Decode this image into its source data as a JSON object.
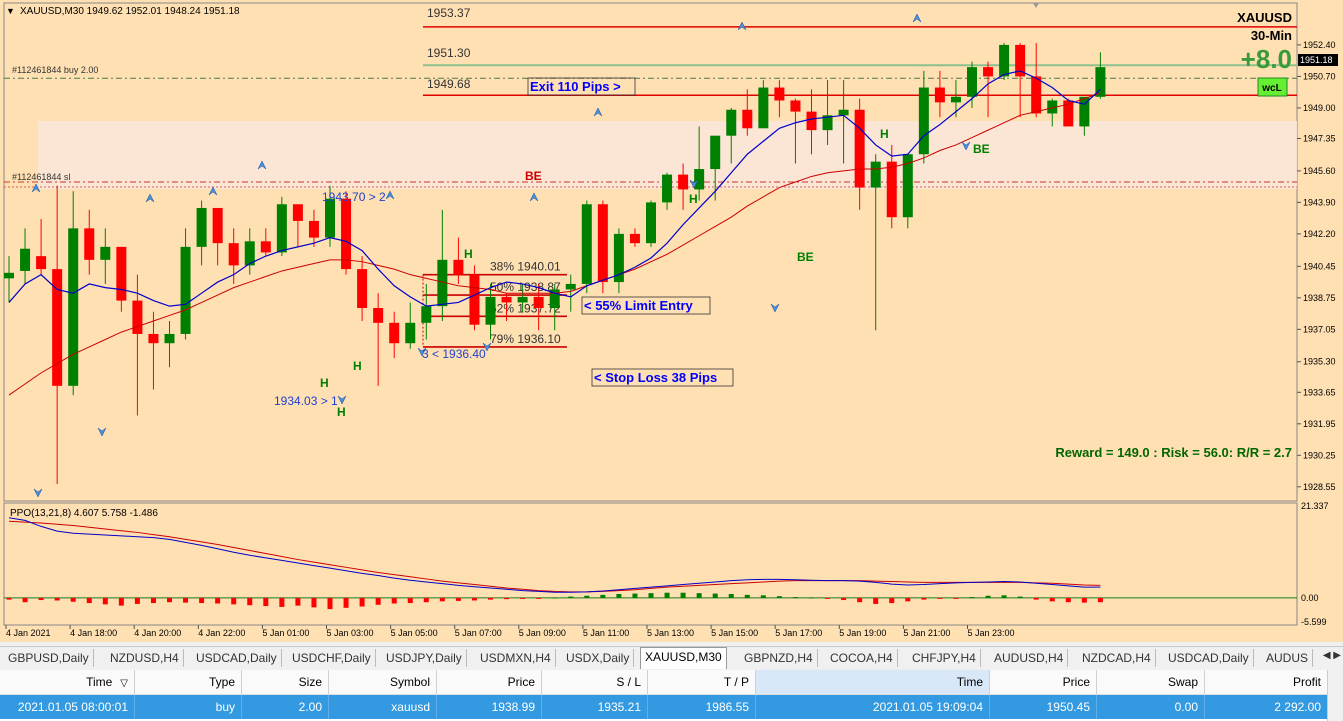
{
  "header": {
    "symbol_info": "XAUUSD,M30  1949.62 1952.01 1948.24 1951.18"
  },
  "overlay": {
    "symbol": "XAUUSD",
    "timeframe": "30-Min",
    "profit_text": "+8.0",
    "badge": "wcL",
    "rr_text": "Reward = 149.0 : Risk = 56.0: R/R = 2.7"
  },
  "colors": {
    "background": "#ffe0b3",
    "bull": "#008000",
    "bear": "#ff0000",
    "ma_fast": "#0000cc",
    "ma_slow": "#cc0000",
    "zone": "#fbe6d8",
    "label_blue": "#0000ff",
    "label_green": "#008000",
    "label_red": "#cc0000"
  },
  "chart_data": [
    {
      "type": "candlestick",
      "title": "XAUUSD,M30",
      "price_ticks": [
        "1952.40",
        "1950.70",
        "1949.00",
        "1947.35",
        "1945.60",
        "1943.90",
        "1942.20",
        "1940.45",
        "1938.75",
        "1937.05",
        "1935.30",
        "1933.65",
        "1931.95",
        "1930.25",
        "1928.55"
      ],
      "current_price": "1951.18",
      "ylim": [
        1928.0,
        1954.5
      ],
      "time_labels": [
        "4 Jan 2021",
        "4 Jan 18:00",
        "4 Jan 20:00",
        "4 Jan 22:00",
        "5 Jan 01:00",
        "5 Jan 03:00",
        "5 Jan 05:00",
        "5 Jan 07:00",
        "5 Jan 09:00",
        "5 Jan 11:00",
        "5 Jan 13:00",
        "5 Jan 15:00",
        "5 Jan 17:00",
        "5 Jan 19:00",
        "5 Jan 21:00",
        "5 Jan 23:00"
      ],
      "candles": [
        {
          "o": 1939.8,
          "h": 1941.0,
          "l": 1938.5,
          "c": 1940.1
        },
        {
          "o": 1940.2,
          "h": 1942.5,
          "l": 1939.5,
          "c": 1941.4
        },
        {
          "o": 1941.0,
          "h": 1943.0,
          "l": 1940.0,
          "c": 1940.3
        },
        {
          "o": 1940.3,
          "h": 1944.8,
          "l": 1928.7,
          "c": 1934.0
        },
        {
          "o": 1934.0,
          "h": 1944.5,
          "l": 1933.5,
          "c": 1942.5
        },
        {
          "o": 1942.5,
          "h": 1943.5,
          "l": 1940.0,
          "c": 1940.8
        },
        {
          "o": 1940.8,
          "h": 1942.5,
          "l": 1939.5,
          "c": 1941.5
        },
        {
          "o": 1941.5,
          "h": 1941.0,
          "l": 1938.0,
          "c": 1938.6
        },
        {
          "o": 1938.6,
          "h": 1940.0,
          "l": 1932.4,
          "c": 1936.8
        },
        {
          "o": 1936.8,
          "h": 1938.0,
          "l": 1933.8,
          "c": 1936.3
        },
        {
          "o": 1936.3,
          "h": 1937.5,
          "l": 1935.0,
          "c": 1936.8
        },
        {
          "o": 1936.8,
          "h": 1942.5,
          "l": 1936.5,
          "c": 1941.5
        },
        {
          "o": 1941.5,
          "h": 1944.0,
          "l": 1940.5,
          "c": 1943.6
        },
        {
          "o": 1943.6,
          "h": 1943.5,
          "l": 1940.5,
          "c": 1941.7
        },
        {
          "o": 1941.7,
          "h": 1942.5,
          "l": 1939.5,
          "c": 1940.5
        },
        {
          "o": 1940.5,
          "h": 1942.5,
          "l": 1940.0,
          "c": 1941.8
        },
        {
          "o": 1941.8,
          "h": 1942.5,
          "l": 1941.0,
          "c": 1941.2
        },
        {
          "o": 1941.2,
          "h": 1944.2,
          "l": 1941.0,
          "c": 1943.8
        },
        {
          "o": 1943.8,
          "h": 1943.5,
          "l": 1941.5,
          "c": 1942.9
        },
        {
          "o": 1942.9,
          "h": 1943.5,
          "l": 1941.5,
          "c": 1942.0
        },
        {
          "o": 1942.0,
          "h": 1944.8,
          "l": 1941.5,
          "c": 1944.1
        },
        {
          "o": 1944.1,
          "h": 1944.5,
          "l": 1940.0,
          "c": 1940.3
        },
        {
          "o": 1940.3,
          "h": 1941.0,
          "l": 1937.5,
          "c": 1938.2
        },
        {
          "o": 1938.2,
          "h": 1939.0,
          "l": 1934.0,
          "c": 1937.4
        },
        {
          "o": 1937.4,
          "h": 1938.0,
          "l": 1935.5,
          "c": 1936.3
        },
        {
          "o": 1936.3,
          "h": 1938.5,
          "l": 1936.0,
          "c": 1937.4
        },
        {
          "o": 1937.4,
          "h": 1939.5,
          "l": 1936.5,
          "c": 1938.3
        },
        {
          "o": 1938.3,
          "h": 1943.5,
          "l": 1937.5,
          "c": 1940.8
        },
        {
          "o": 1940.8,
          "h": 1942.0,
          "l": 1939.5,
          "c": 1940.0
        },
        {
          "o": 1940.0,
          "h": 1940.5,
          "l": 1937.0,
          "c": 1937.3
        },
        {
          "o": 1937.3,
          "h": 1939.5,
          "l": 1936.5,
          "c": 1938.8
        },
        {
          "o": 1938.8,
          "h": 1939.0,
          "l": 1937.5,
          "c": 1938.5
        },
        {
          "o": 1938.5,
          "h": 1939.5,
          "l": 1938.0,
          "c": 1938.8
        },
        {
          "o": 1938.8,
          "h": 1939.5,
          "l": 1937.0,
          "c": 1938.2
        },
        {
          "o": 1938.2,
          "h": 1939.5,
          "l": 1937.0,
          "c": 1939.2
        },
        {
          "o": 1939.2,
          "h": 1940.0,
          "l": 1938.0,
          "c": 1939.5
        },
        {
          "o": 1939.5,
          "h": 1944.0,
          "l": 1939.0,
          "c": 1943.8
        },
        {
          "o": 1943.8,
          "h": 1944.0,
          "l": 1939.0,
          "c": 1939.6
        },
        {
          "o": 1939.6,
          "h": 1942.5,
          "l": 1939.0,
          "c": 1942.2
        },
        {
          "o": 1942.2,
          "h": 1942.5,
          "l": 1941.5,
          "c": 1941.7
        },
        {
          "o": 1941.7,
          "h": 1944.0,
          "l": 1941.5,
          "c": 1943.9
        },
        {
          "o": 1943.9,
          "h": 1945.5,
          "l": 1943.5,
          "c": 1945.4
        },
        {
          "o": 1945.4,
          "h": 1946.0,
          "l": 1943.5,
          "c": 1944.6
        },
        {
          "o": 1944.6,
          "h": 1948.0,
          "l": 1944.0,
          "c": 1945.7
        },
        {
          "o": 1945.7,
          "h": 1947.5,
          "l": 1944.0,
          "c": 1947.5
        },
        {
          "o": 1947.5,
          "h": 1949.0,
          "l": 1946.0,
          "c": 1948.9
        },
        {
          "o": 1948.9,
          "h": 1950.0,
          "l": 1947.5,
          "c": 1947.9
        },
        {
          "o": 1947.9,
          "h": 1950.5,
          "l": 1948.0,
          "c": 1950.1
        },
        {
          "o": 1950.1,
          "h": 1950.5,
          "l": 1948.5,
          "c": 1949.4
        },
        {
          "o": 1949.4,
          "h": 1949.5,
          "l": 1946.0,
          "c": 1948.8
        },
        {
          "o": 1948.8,
          "h": 1950.0,
          "l": 1946.5,
          "c": 1947.8
        },
        {
          "o": 1947.8,
          "h": 1950.5,
          "l": 1947.0,
          "c": 1948.6
        },
        {
          "o": 1948.6,
          "h": 1950.5,
          "l": 1946.0,
          "c": 1948.9
        },
        {
          "o": 1948.9,
          "h": 1949.5,
          "l": 1943.5,
          "c": 1944.7
        },
        {
          "o": 1944.7,
          "h": 1946.5,
          "l": 1937.0,
          "c": 1946.1
        },
        {
          "o": 1946.1,
          "h": 1947.0,
          "l": 1942.5,
          "c": 1943.1
        },
        {
          "o": 1943.1,
          "h": 1946.0,
          "l": 1942.5,
          "c": 1946.5
        },
        {
          "o": 1946.5,
          "h": 1951.0,
          "l": 1946.0,
          "c": 1950.1
        },
        {
          "o": 1950.1,
          "h": 1951.0,
          "l": 1948.5,
          "c": 1949.3
        },
        {
          "o": 1949.3,
          "h": 1950.5,
          "l": 1948.5,
          "c": 1949.6
        },
        {
          "o": 1949.6,
          "h": 1951.5,
          "l": 1949.0,
          "c": 1951.2
        },
        {
          "o": 1951.2,
          "h": 1951.5,
          "l": 1948.5,
          "c": 1950.7
        },
        {
          "o": 1950.7,
          "h": 1952.5,
          "l": 1950.5,
          "c": 1952.4
        },
        {
          "o": 1952.4,
          "h": 1952.5,
          "l": 1948.5,
          "c": 1950.7
        },
        {
          "o": 1950.7,
          "h": 1952.5,
          "l": 1948.5,
          "c": 1948.7
        },
        {
          "o": 1948.7,
          "h": 1949.5,
          "l": 1948.0,
          "c": 1949.4
        },
        {
          "o": 1949.4,
          "h": 1949.5,
          "l": 1948.0,
          "c": 1948.0
        },
        {
          "o": 1948.0,
          "h": 1949.5,
          "l": 1947.5,
          "c": 1949.6
        },
        {
          "o": 1949.6,
          "h": 1952.0,
          "l": 1949.5,
          "c": 1951.2
        }
      ],
      "ma_fast": [
        1938.5,
        1939.5,
        1940.0,
        1939.2,
        1939.0,
        1939.5,
        1939.3,
        1939.2,
        1939.0,
        1938.6,
        1938.3,
        1938.4,
        1939.0,
        1939.6,
        1940.0,
        1940.6,
        1941.0,
        1941.3,
        1941.5,
        1941.7,
        1942.0,
        1941.8,
        1941.3,
        1940.3,
        1939.4,
        1938.8,
        1938.3,
        1938.4,
        1938.5,
        1938.9,
        1939.3,
        1939.6,
        1939.5,
        1939.3,
        1939.0,
        1938.8,
        1939.4,
        1939.7,
        1940.0,
        1940.4,
        1940.9,
        1941.7,
        1942.7,
        1943.6,
        1944.5,
        1945.5,
        1946.5,
        1947.2,
        1947.9,
        1948.2,
        1948.4,
        1948.5,
        1948.6,
        1947.9,
        1947.0,
        1946.4,
        1946.5,
        1947.5,
        1948.1,
        1948.8,
        1949.5,
        1950.3,
        1950.8,
        1951.0,
        1950.6,
        1950.1,
        1949.4,
        1949.2,
        1950.0
      ],
      "ma_slow": [
        1933.5,
        1934.1,
        1934.7,
        1935.2,
        1935.7,
        1936.1,
        1936.5,
        1936.9,
        1937.2,
        1937.5,
        1937.8,
        1938.1,
        1938.5,
        1938.9,
        1939.3,
        1939.6,
        1939.9,
        1940.2,
        1940.4,
        1940.6,
        1940.8,
        1940.8,
        1940.7,
        1940.5,
        1940.3,
        1940.0,
        1939.8,
        1939.6,
        1939.4,
        1939.3,
        1939.2,
        1939.0,
        1939.0,
        1939.0,
        1939.0,
        1939.1,
        1939.4,
        1939.7,
        1940.0,
        1940.3,
        1940.7,
        1941.1,
        1941.6,
        1942.1,
        1942.6,
        1943.1,
        1943.7,
        1944.2,
        1944.7,
        1945.0,
        1945.3,
        1945.5,
        1945.6,
        1945.7,
        1945.7,
        1945.8,
        1946.0,
        1946.3,
        1946.7,
        1947.0,
        1947.4,
        1947.8,
        1948.2,
        1948.6,
        1948.8,
        1949.0,
        1949.2,
        1949.5,
        1949.8
      ],
      "levels": [
        {
          "label": "1953.37",
          "value": 1953.37,
          "color": "#e00000"
        },
        {
          "label": "1951.30",
          "value": 1951.3,
          "color": "#8cc08c"
        },
        {
          "label": "1949.68",
          "value": 1949.68,
          "color": "#e00000"
        }
      ],
      "order_lines": [
        {
          "label": "#112461844 buy 2.00",
          "value": 1950.6
        },
        {
          "label": "#112461844 sl",
          "value": 1945.0
        }
      ],
      "fib_levels": [
        {
          "label": "38% 1940.01",
          "value": 1940.0
        },
        {
          "label": "50% 1938.87",
          "value": 1938.9
        },
        {
          "label": "62% 1937.72",
          "value": 1937.75
        },
        {
          "label": "79% 1936.10",
          "value": 1936.1
        }
      ],
      "annotations": {
        "exit_label": "Exit 110 Pips >",
        "limit_entry_label": "< 55% Limit Entry",
        "stop_loss_label": "< Stop Loss 38 Pips",
        "be_labels": [
          "BE",
          "BE",
          "BE"
        ],
        "h_labels": [
          "H",
          "H",
          "H",
          "H",
          "H",
          "H"
        ],
        "level_a": "1943.70 > 2",
        "level_b": "1934.03 > 1",
        "level_c": "3 < 1936.40"
      }
    },
    {
      "type": "bar",
      "title": "PPO(13,21,8) 4.607 5.758 -1.486",
      "ticks": [
        "21.337",
        "0.00",
        "-5.599"
      ],
      "ylim": [
        -5.6,
        21.34
      ],
      "ppo_line": [
        18.6,
        18.0,
        16.6,
        15.5,
        15.0,
        14.8,
        14.6,
        14.4,
        14.2,
        14.0,
        13.6,
        12.9,
        12.2,
        11.4,
        10.6,
        9.9,
        9.3,
        8.7,
        8.1,
        7.5,
        6.9,
        6.3,
        5.7,
        5.2,
        4.6,
        4.1,
        3.7,
        3.3,
        2.9,
        2.6,
        2.3,
        2.0,
        1.7,
        1.5,
        1.3,
        1.3,
        1.4,
        1.6,
        1.9,
        2.2,
        2.5,
        2.8,
        3.1,
        3.4,
        3.7,
        4.0,
        4.2,
        4.3,
        4.3,
        4.2,
        4.1,
        4.0,
        4.0,
        3.9,
        3.6,
        3.2,
        3.0,
        3.1,
        3.3,
        3.5,
        3.6,
        3.7,
        3.8,
        3.7,
        3.4,
        3.1,
        2.8,
        2.5,
        2.5
      ],
      "signal_line": [
        17.8,
        17.6,
        17.4,
        17.1,
        16.8,
        16.4,
        16.0,
        15.6,
        15.2,
        14.7,
        14.2,
        13.6,
        13.0,
        12.4,
        11.7,
        11.0,
        10.3,
        9.6,
        8.9,
        8.3,
        7.7,
        7.1,
        6.5,
        5.9,
        5.4,
        4.9,
        4.4,
        3.9,
        3.5,
        3.1,
        2.7,
        2.3,
        2.0,
        1.7,
        1.5,
        1.4,
        1.4,
        1.5,
        1.7,
        1.9,
        2.2,
        2.5,
        2.7,
        2.9,
        3.1,
        3.3,
        3.5,
        3.7,
        3.9,
        4.0,
        4.0,
        4.0,
        4.0,
        4.0,
        3.9,
        3.8,
        3.7,
        3.6,
        3.6,
        3.6,
        3.6,
        3.6,
        3.6,
        3.6,
        3.5,
        3.4,
        3.2,
        3.0,
        2.9
      ],
      "histogram": [
        -0.4,
        -1.0,
        -0.5,
        -0.6,
        -0.9,
        -1.2,
        -1.5,
        -1.8,
        -1.4,
        -1.2,
        -1.0,
        -1.1,
        -1.2,
        -1.3,
        -1.5,
        -1.7,
        -1.9,
        -2.1,
        -1.8,
        -2.2,
        -2.6,
        -2.3,
        -2.0,
        -1.6,
        -1.3,
        -1.2,
        -1.0,
        -0.8,
        -0.7,
        -0.6,
        -0.4,
        -0.3,
        -0.2,
        -0.1,
        0.1,
        0.3,
        0.5,
        0.7,
        0.9,
        1.0,
        1.1,
        1.2,
        1.2,
        1.1,
        1.0,
        0.9,
        0.7,
        0.6,
        0.4,
        0.2,
        0.1,
        -0.1,
        -0.5,
        -1.0,
        -1.4,
        -1.2,
        -0.8,
        -0.4,
        -0.2,
        -0.1,
        0.2,
        0.5,
        0.6,
        0.3,
        -0.4,
        -0.8,
        -1.0,
        -1.1,
        -1.0
      ]
    }
  ],
  "tabs": [
    "GBPUSD,Daily",
    "NZDUSD,H4",
    "USDCAD,Daily",
    "USDCHF,Daily",
    "USDJPY,Daily",
    "USDMXN,H4",
    "USDX,Daily",
    "XAUUSD,M30",
    "GBPNZD,H4",
    "COCOA,H4",
    "CHFJPY,H4",
    "AUDUSD,H4",
    "NZDCAD,H4",
    "USDCAD,Daily",
    "AUDUS"
  ],
  "active_tab": 7,
  "tab_arrows": "◀ ▶",
  "trade_table": {
    "headers": [
      "Time",
      "Type",
      "Size",
      "Symbol",
      "Price",
      "S / L",
      "T / P",
      "Time",
      "Price",
      "Swap",
      "Profit"
    ],
    "sort_indicator": "▽",
    "row": [
      "2021.01.05 08:00:01",
      "buy",
      "2.00",
      "xauusd",
      "1938.99",
      "1935.21",
      "1986.55",
      "2021.01.05 19:09:04",
      "1950.45",
      "0.00",
      "2 292.00"
    ]
  }
}
